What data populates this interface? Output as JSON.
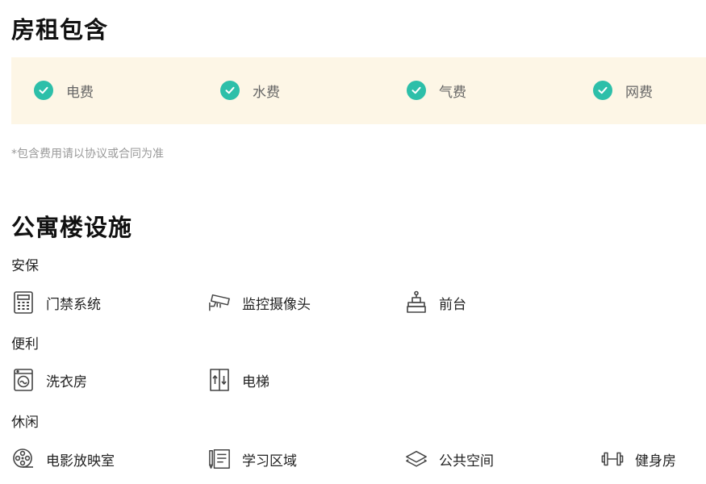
{
  "rent_included": {
    "title": "房租包含",
    "items": [
      {
        "label": "电费",
        "icon": "check-icon"
      },
      {
        "label": "水费",
        "icon": "check-icon"
      },
      {
        "label": "气费",
        "icon": "check-icon"
      },
      {
        "label": "网费",
        "icon": "check-icon"
      }
    ],
    "note": "*包含费用请以协议或合同为准",
    "check_color": "#2dbfa9",
    "box_color": "#fdf6e6"
  },
  "facilities": {
    "title": "公寓楼设施",
    "categories": [
      {
        "label": "安保",
        "items": [
          {
            "label": "门禁系统",
            "icon": "access-keypad-icon"
          },
          {
            "label": "监控摄像头",
            "icon": "cctv-camera-icon"
          },
          {
            "label": "前台",
            "icon": "reception-bell-icon"
          }
        ]
      },
      {
        "label": "便利",
        "items": [
          {
            "label": "洗衣房",
            "icon": "washing-machine-icon"
          },
          {
            "label": "电梯",
            "icon": "elevator-icon"
          }
        ]
      },
      {
        "label": "休闲",
        "items": [
          {
            "label": "电影放映室",
            "icon": "film-reel-icon"
          },
          {
            "label": "学习区域",
            "icon": "notebook-pen-icon"
          },
          {
            "label": "公共空间",
            "icon": "layers-icon"
          },
          {
            "label": "健身房",
            "icon": "dumbbell-icon"
          }
        ]
      }
    ]
  }
}
